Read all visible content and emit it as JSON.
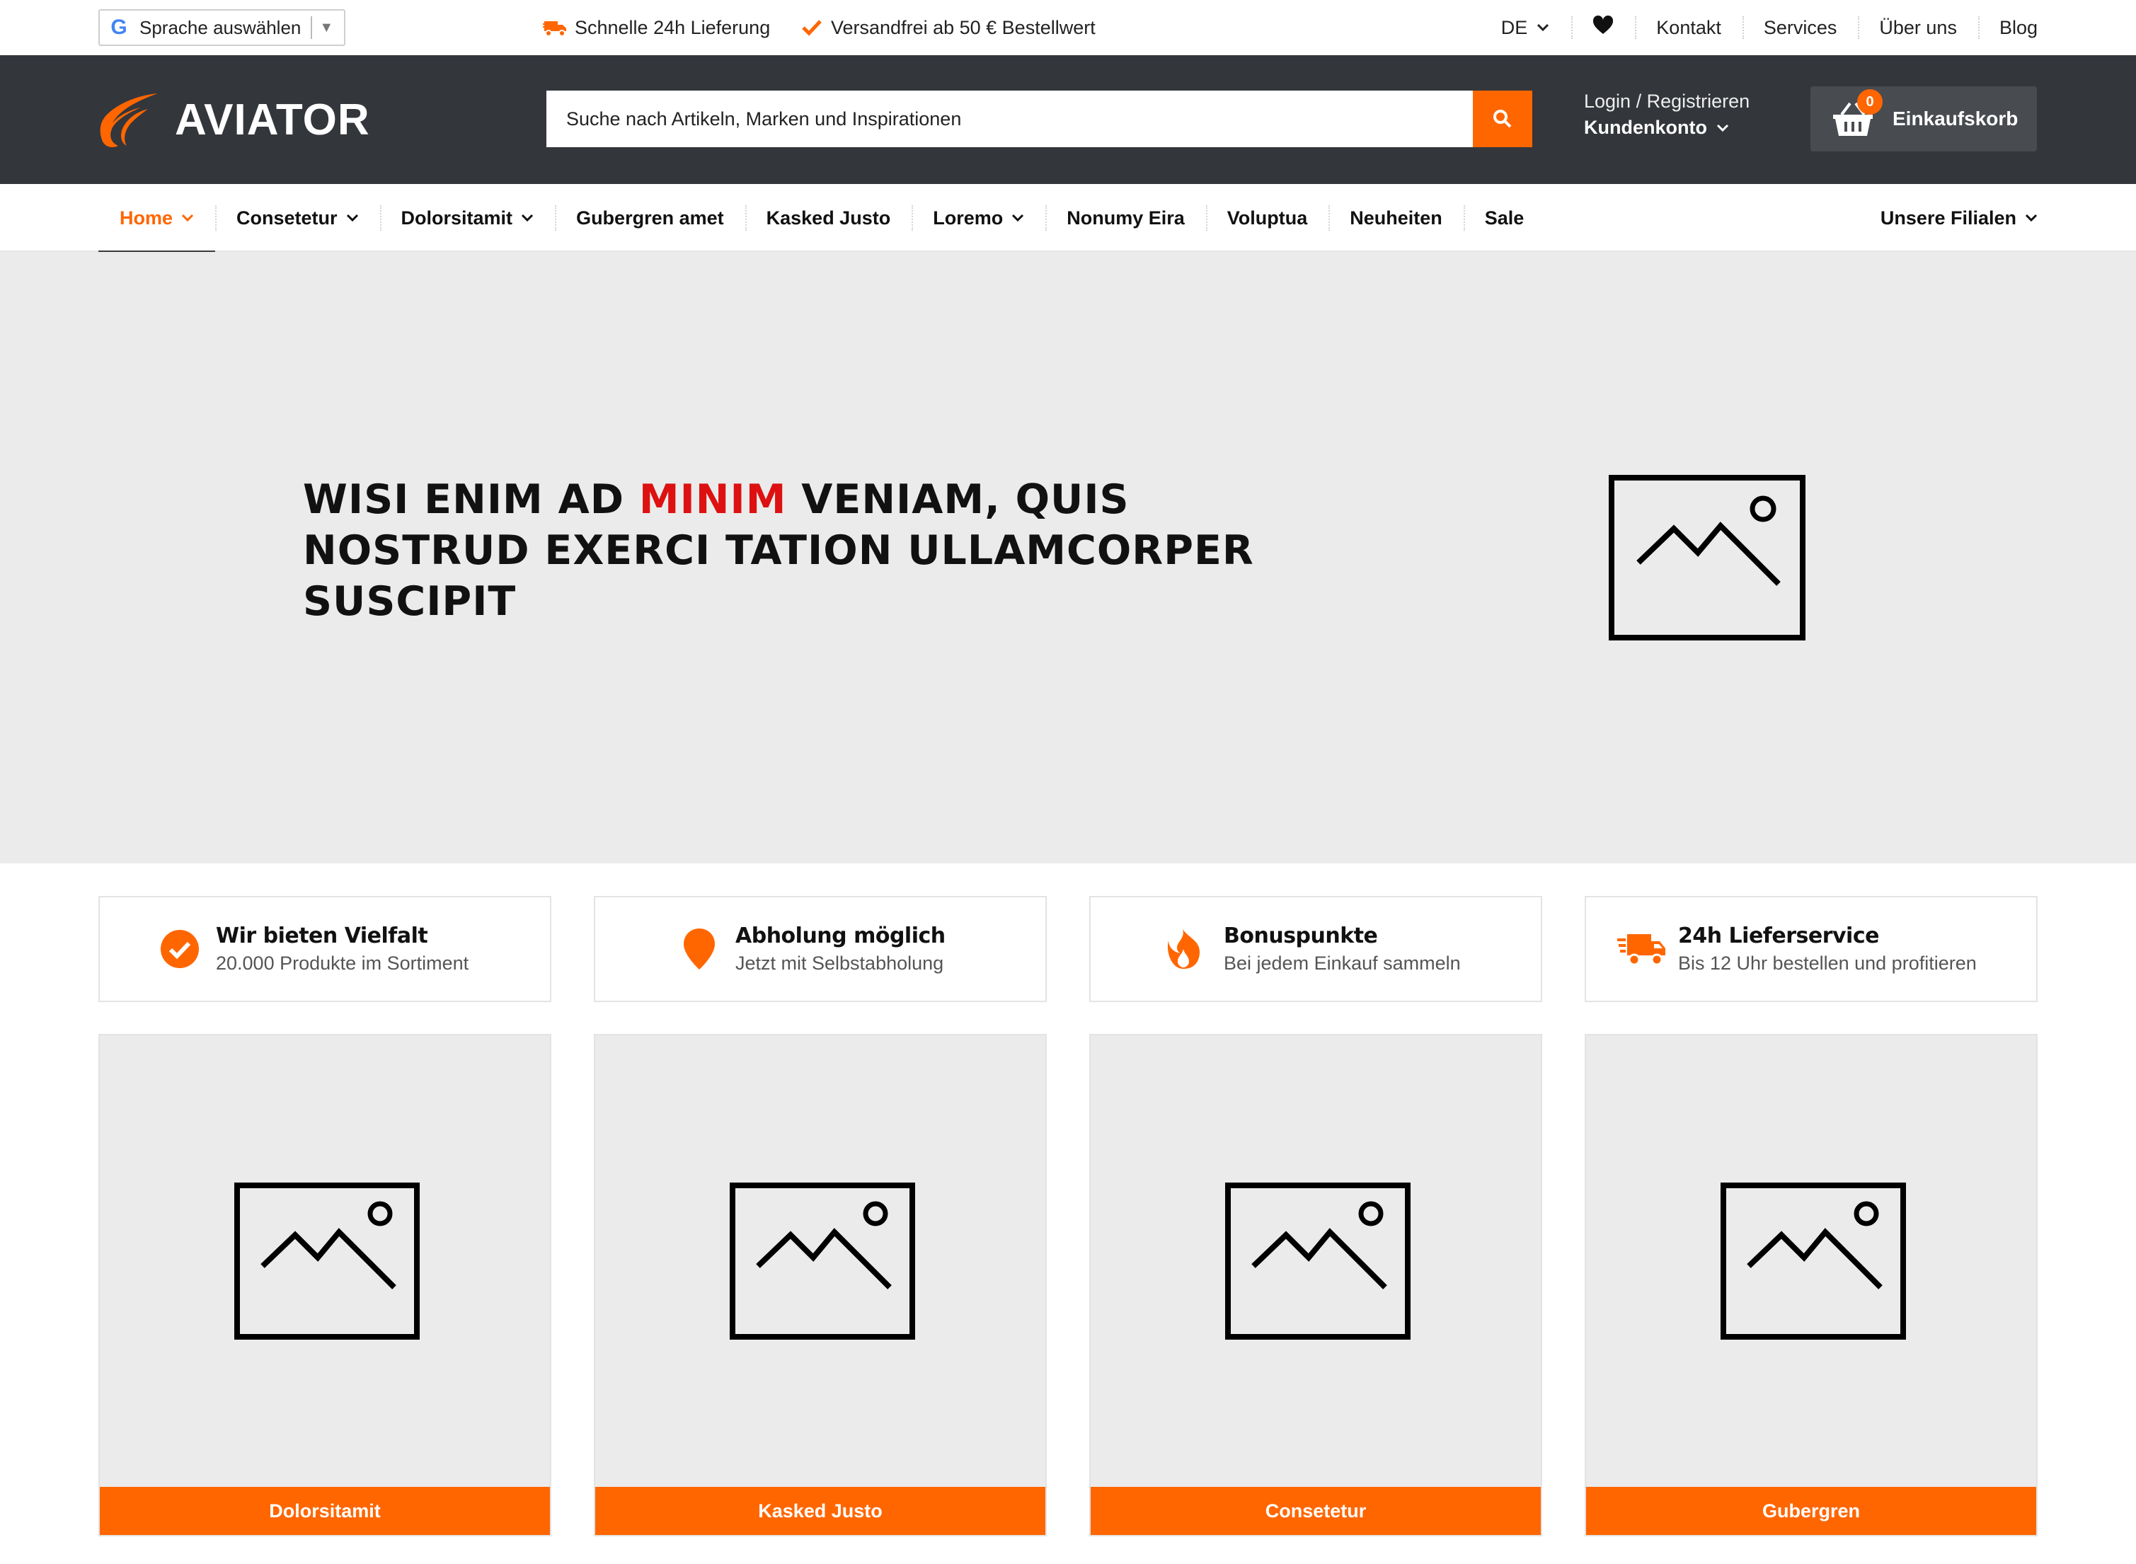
{
  "colors": {
    "accent": "#ff6600",
    "header_bg": "#33363b",
    "hero_bg": "#ebebeb",
    "headline_accent": "#dd1111"
  },
  "topbar": {
    "language_select_label": "Sprache auswählen",
    "google_letter": "G",
    "usp_delivery": "Schnelle 24h Lieferung",
    "usp_shipping": "Versandfrei ab 50 € Bestellwert",
    "lang_code": "DE",
    "links": {
      "contact": "Kontakt",
      "services": "Services",
      "about": "Über uns",
      "blog": "Blog"
    }
  },
  "header": {
    "brand": "AVIATOR",
    "search_placeholder": "Suche nach Artikeln, Marken und Inspirationen",
    "account_line1": "Login / Registrieren",
    "account_line2": "Kundenkonto",
    "cart_count": "0",
    "cart_label": "Einkaufskorb"
  },
  "mainnav": {
    "items": [
      {
        "label": "Home"
      },
      {
        "label": "Consetetur"
      },
      {
        "label": "Dolorsitamit"
      },
      {
        "label": "Gubergren amet"
      },
      {
        "label": "Kasked Justo"
      },
      {
        "label": "Loremo"
      },
      {
        "label": "Nonumy Eira"
      },
      {
        "label": "Voluptua"
      },
      {
        "label": "Neuheiten"
      },
      {
        "label": "Sale"
      }
    ],
    "stores": "Unsere Filialen"
  },
  "hero": {
    "headline_part1": "WISI ENIM AD ",
    "headline_accent": "MINIM",
    "headline_part2": " VENIAM, QUIS NOSTRUD EXERCI TATION ULLAMCORPER SUSCIPIT"
  },
  "usps": [
    {
      "title": "Wir bieten Vielfalt",
      "subtitle": "20.000 Produkte im Sortiment",
      "icon": "check-circle-icon"
    },
    {
      "title": "Abholung möglich",
      "subtitle": "Jetzt mit Selbstabholung",
      "icon": "map-pin-icon"
    },
    {
      "title": "Bonuspunkte",
      "subtitle": "Bei jedem Einkauf sammeln",
      "icon": "flame-icon"
    },
    {
      "title": "24h Lieferservice",
      "subtitle": "Bis 12 Uhr bestellen und profitieren",
      "icon": "delivery-truck-icon"
    }
  ],
  "tiles": [
    {
      "label": "Dolorsitamit"
    },
    {
      "label": "Kasked Justo"
    },
    {
      "label": "Consetetur"
    },
    {
      "label": "Gubergren"
    }
  ]
}
